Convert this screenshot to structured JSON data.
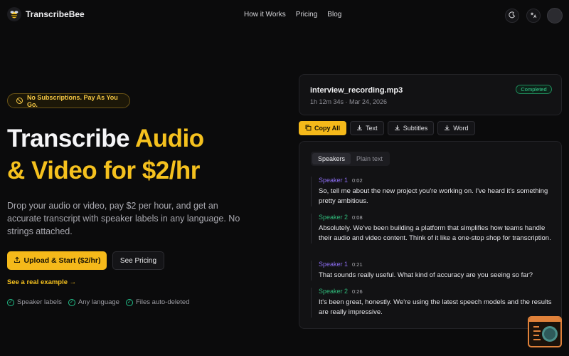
{
  "brand": {
    "name": "TranscribeBee"
  },
  "nav": {
    "items": [
      "How it Works",
      "Pricing",
      "Blog"
    ]
  },
  "header": {
    "theme_icon": "moon-icon",
    "language_icon": "translate-icon"
  },
  "hero": {
    "badge": "No Subscriptions. Pay As You Go.",
    "headline_line1_plain": "Transcribe ",
    "headline_line1_accent": "Audio",
    "headline_line2_accent": "& Video for $2/hr",
    "subtext": "Drop your audio or video, pay $2 per hour, and get an accurate transcript with speaker labels in any language. No strings attached.",
    "primary_button": "Upload & Start ($2/hr)",
    "secondary_button": "See Pricing",
    "example_link": "See a real example →",
    "features": [
      "Speaker labels",
      "Any language",
      "Files auto-deleted"
    ]
  },
  "file": {
    "name": "interview_recording.mp3",
    "meta": "1h 12m 34s · Mar 24, 2026",
    "status": "Completed"
  },
  "toolbar": {
    "buttons": [
      "Copy All",
      "Text",
      "Subtitles",
      "Word"
    ]
  },
  "transcript": {
    "tabs": [
      "Speakers",
      "Plain text"
    ],
    "segments": [
      {
        "speaker": "Speaker 1",
        "time": "0:02",
        "text": "So, tell me about the new project you're working on. I've heard it's something pretty ambitious."
      },
      {
        "speaker": "Speaker 2",
        "time": "0:08",
        "text": "Absolutely. We've been building a platform that simplifies how teams handle their audio and video content. Think of it like a one-stop shop for transcription."
      },
      {
        "speaker": "Speaker 1",
        "time": "0:21",
        "text": "That sounds really useful. What kind of accuracy are you seeing so far?"
      },
      {
        "speaker": "Speaker 2",
        "time": "0:26",
        "text": "It's been great, honestly. We're using the latest speech models and the results are really impressive."
      }
    ]
  },
  "colors": {
    "accent": "#f5c11e",
    "speaker1": "#8b6cf0",
    "speaker2": "#2fb879",
    "success": "#35d08f"
  }
}
